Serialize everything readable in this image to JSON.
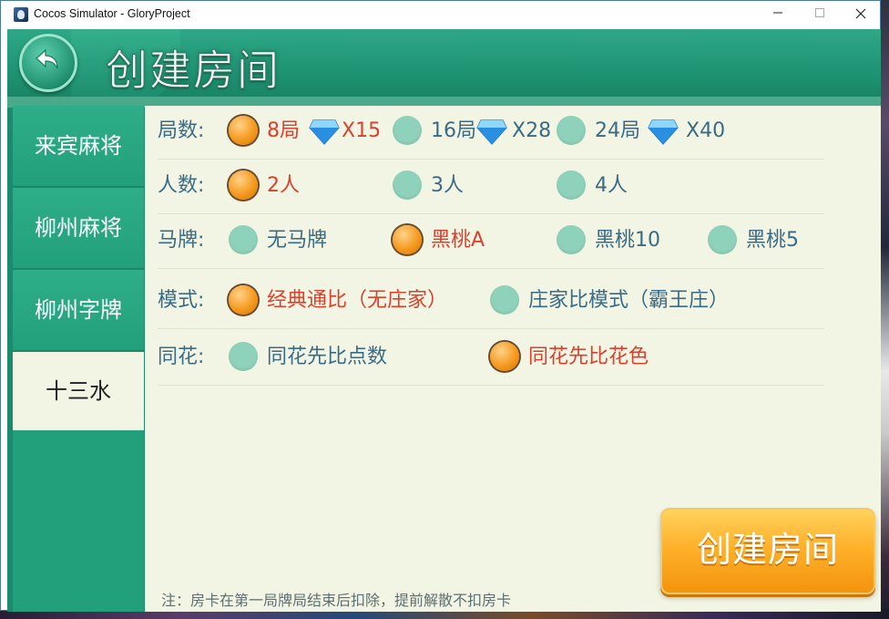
{
  "window": {
    "title": "Cocos Simulator - GloryProject",
    "minimize_icon": "minimize-icon",
    "maximize_icon": "maximize-icon",
    "close_icon": "close-icon"
  },
  "header": {
    "title": "创建房间",
    "back_icon": "back-arrow-icon"
  },
  "sidebar": {
    "tabs": [
      {
        "label": "来宾麻将",
        "active": false
      },
      {
        "label": "柳州麻将",
        "active": false
      },
      {
        "label": "柳州字牌",
        "active": false
      },
      {
        "label": "十三水",
        "active": true
      }
    ]
  },
  "settings": {
    "rounds": {
      "label": "局数:",
      "options": [
        {
          "text": "8局",
          "cost": "X15",
          "selected": true
        },
        {
          "text": "16局",
          "cost": "X28",
          "selected": false
        },
        {
          "text": "24局",
          "cost": "X40",
          "selected": false
        }
      ]
    },
    "players": {
      "label": "人数:",
      "options": [
        {
          "text": "2人",
          "selected": true
        },
        {
          "text": "3人",
          "selected": false
        },
        {
          "text": "4人",
          "selected": false
        }
      ]
    },
    "horse": {
      "label": "马牌:",
      "options": [
        {
          "text": "无马牌",
          "selected": false
        },
        {
          "text": "黑桃A",
          "selected": true
        },
        {
          "text": "黑桃10",
          "selected": false
        },
        {
          "text": "黑桃5",
          "selected": false
        }
      ]
    },
    "mode": {
      "label": "模式:",
      "options": [
        {
          "text": "经典通比（无庄家）",
          "selected": true
        },
        {
          "text": "庄家比模式（霸王庄）",
          "selected": false
        }
      ]
    },
    "flush": {
      "label": "同花:",
      "options": [
        {
          "text": "同花先比点数",
          "selected": false
        },
        {
          "text": "同花先比花色",
          "selected": true
        }
      ]
    }
  },
  "colors": {
    "selected_text": "#d9412d",
    "unselected_text": "#3a6b86",
    "panel": "#f3f5e4",
    "green": "#22a07c"
  },
  "create_button": {
    "label": "创建房间"
  },
  "note": "注：房卡在第一局牌局结束后扣除，提前解散不扣房卡"
}
